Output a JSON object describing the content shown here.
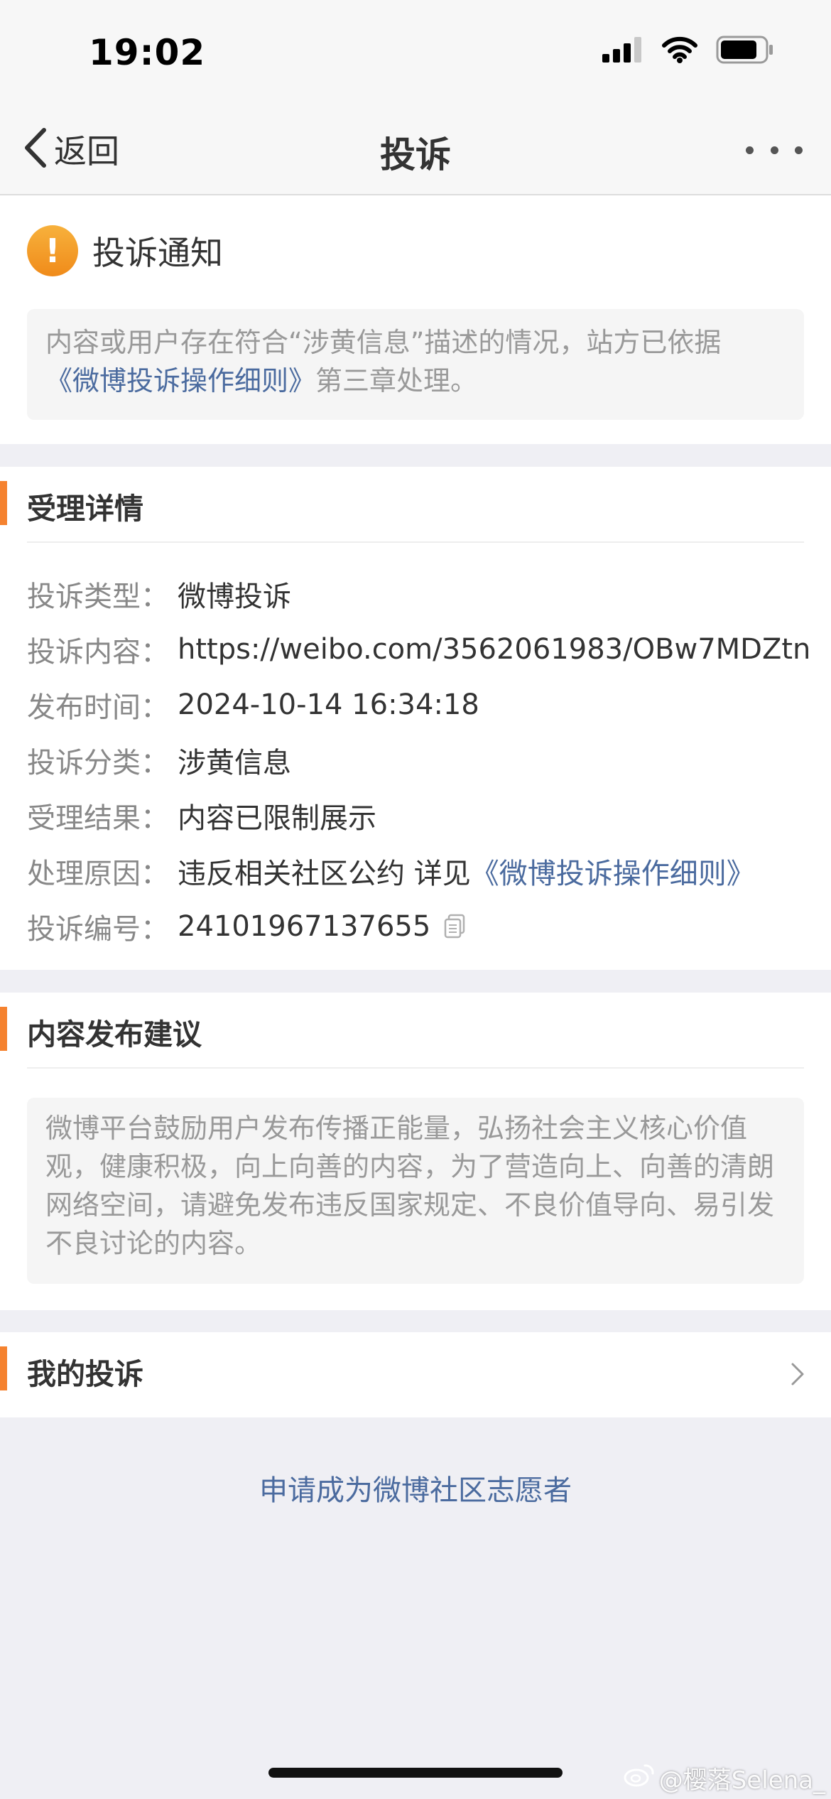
{
  "status_bar": {
    "time": "19:02"
  },
  "nav": {
    "back_label": "返回",
    "title": "投诉"
  },
  "notice": {
    "title": "投诉通知",
    "text_before": "内容或用户存在符合“涉黄信息”描述的情况，站方已依据",
    "rules_link": "《微博投诉操作细则》",
    "text_after": "第三章处理。"
  },
  "details": {
    "section_title": "受理详情",
    "rows": [
      {
        "label": "投诉类型：",
        "value": "微博投诉"
      },
      {
        "label": "投诉内容：",
        "value": "https://weibo.com/3562061983/OBw7MDZtn"
      },
      {
        "label": "发布时间：",
        "value": "2024-10-14 16:34:18"
      },
      {
        "label": "投诉分类：",
        "value": "涉黄信息"
      },
      {
        "label": "受理结果：",
        "value": "内容已限制展示"
      },
      {
        "label": "处理原因：",
        "value": "违反相关社区公约 详见",
        "link": "《微博投诉操作细则》"
      },
      {
        "label": "投诉编号：",
        "value": "24101967137655"
      }
    ]
  },
  "advice": {
    "section_title": "内容发布建议",
    "text": "微博平台鼓励用户发布传播正能量，弘扬社会主义核心价值观，健康积极，向上向善的内容，为了营造向上、向善的清朗网络空间，请避免发布违反国家规定、不良价值导向、易引发不良讨论的内容。"
  },
  "my_complaints": {
    "label": "我的投诉"
  },
  "volunteer_link": "申请成为微博社区志愿者",
  "watermark": "@樱落Selena_",
  "colors": {
    "accent_orange": "#f5822f",
    "link_blue": "#4b6b9f",
    "background": "#efeff4"
  }
}
